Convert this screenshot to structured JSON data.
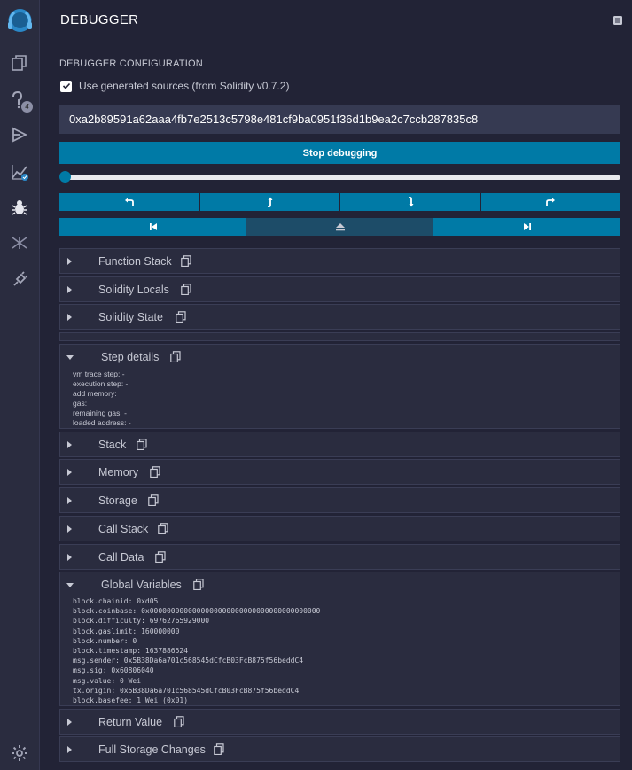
{
  "header": {
    "title": "DEBUGGER"
  },
  "config": {
    "label": "DEBUGGER CONFIGURATION",
    "use_generated_sources_label": "Use generated sources (from Solidity v0.7.2)"
  },
  "tx_hash": "0xa2b89591a62aaa4fb7e2513c5798e481cf9ba0951f36d1b9ea2c7ccb287835c8",
  "stop_label": "Stop debugging",
  "iconbar": {
    "badge_count": "4"
  },
  "sections": {
    "function_stack": "Function Stack",
    "solidity_locals": "Solidity Locals",
    "solidity_state": "Solidity State",
    "step_details": "Step details",
    "stack": "Stack",
    "memory": "Memory",
    "storage": "Storage",
    "call_stack": "Call Stack",
    "call_data": "Call Data",
    "global_variables": "Global Variables",
    "return_value": "Return Value",
    "full_storage_changes": "Full Storage Changes"
  },
  "step_details": [
    "vm trace step: -",
    "execution step: -",
    "add memory:",
    "gas:",
    "remaining gas: -",
    "loaded address: -"
  ],
  "global_variables": [
    "block.chainid: 0xd05",
    "block.coinbase: 0x0000000000000000000000000000000000000000",
    "block.difficulty: 69762765929000",
    "block.gaslimit: 160000000",
    "block.number: 0",
    "block.timestamp: 1637886524",
    "msg.sender: 0x5B38Da6a701c568545dCfcB03FcB875f56beddC4",
    "msg.sig: 0x60806040",
    "msg.value: 0 Wei",
    "tx.origin: 0x5B38Da6a701c568545dCfcB03FcB875f56beddC4",
    "block.basefee: 1 Wei (0x01)"
  ]
}
